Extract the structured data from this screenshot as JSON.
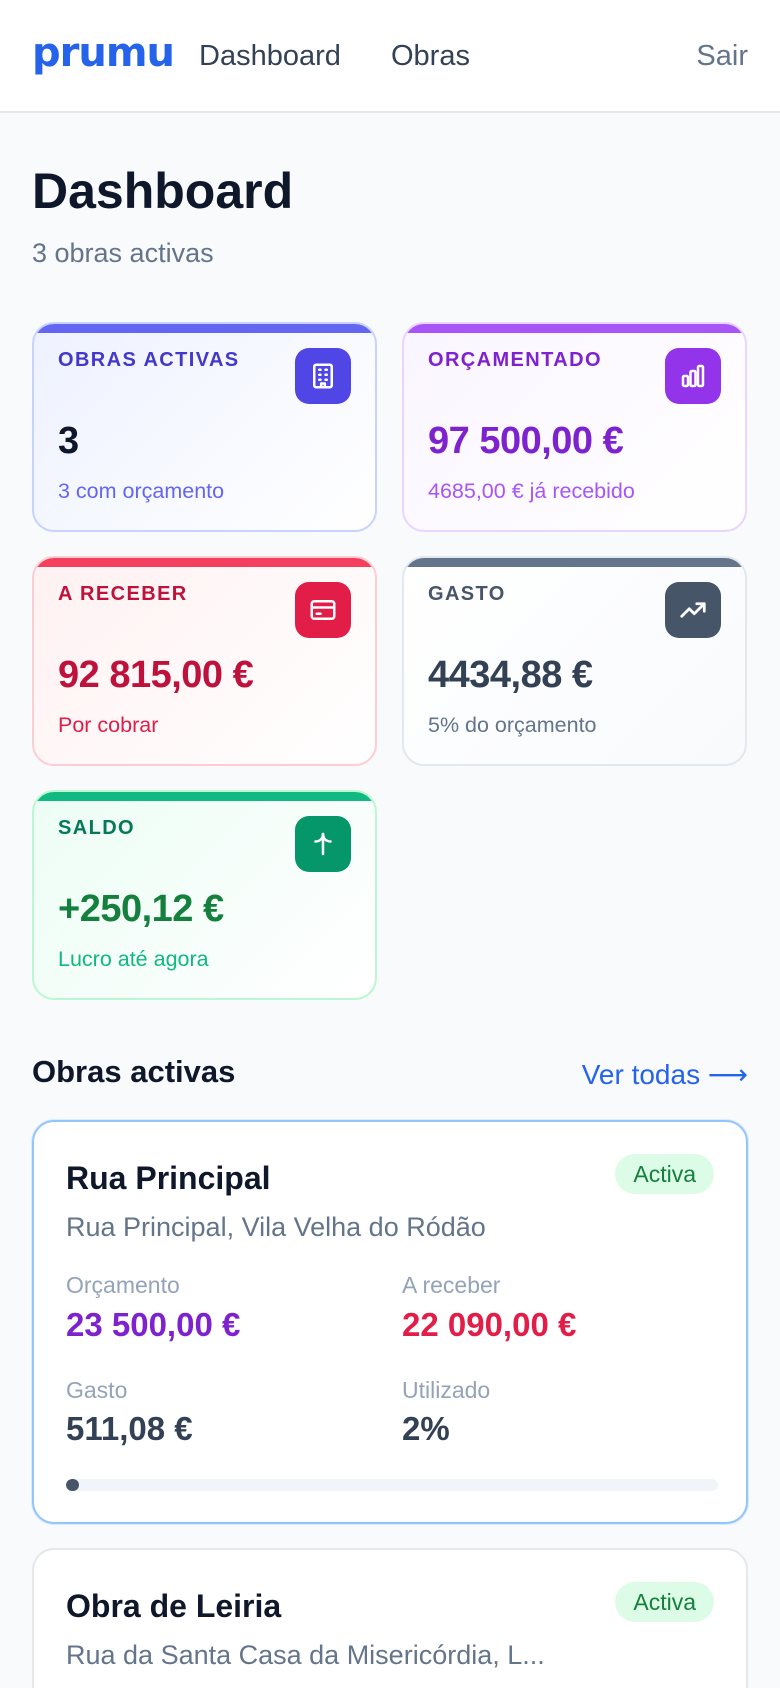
{
  "header": {
    "logo": "prumu",
    "nav": [
      "Dashboard",
      "Obras"
    ],
    "logout": "Sair"
  },
  "page": {
    "title": "Dashboard",
    "subtitle": "3 obras activas"
  },
  "stats": [
    {
      "label": "OBRAS ACTIVAS",
      "value": "3",
      "sub": "3 com orçamento",
      "icon": "building-icon"
    },
    {
      "label": "ORÇAMENTADO",
      "value": "97 500,00 €",
      "sub": "4685,00 € já recebido",
      "icon": "bar-chart-icon"
    },
    {
      "label": "A RECEBER",
      "value": "92 815,00 €",
      "sub": "Por cobrar",
      "icon": "credit-card-icon"
    },
    {
      "label": "GASTO",
      "value": "4434,88 €",
      "sub": "5% do orçamento",
      "icon": "trending-up-icon"
    },
    {
      "label": "SALDO",
      "value": "+250,12 €",
      "sub": "Lucro até agora",
      "icon": "plus-sparkle-icon"
    }
  ],
  "section": {
    "title": "Obras activas",
    "link": "Ver todas ⟶"
  },
  "projects": [
    {
      "name": "Rua Principal",
      "address": "Rua Principal, Vila Velha do Ródão",
      "status": "Activa",
      "budget_label": "Orçamento",
      "budget": "23 500,00 €",
      "receivable_label": "A receber",
      "receivable": "22 090,00 €",
      "spent_label": "Gasto",
      "spent": "511,08 €",
      "used_label": "Utilizado",
      "used": "2%",
      "progress": 0.02
    },
    {
      "name": "Obra de Leiria",
      "address": "Rua da Santa Casa da Misericórdia, L...",
      "status": "Activa"
    }
  ],
  "colors": {
    "brand": "#2563eb",
    "active_badge": "#dcfce7"
  }
}
